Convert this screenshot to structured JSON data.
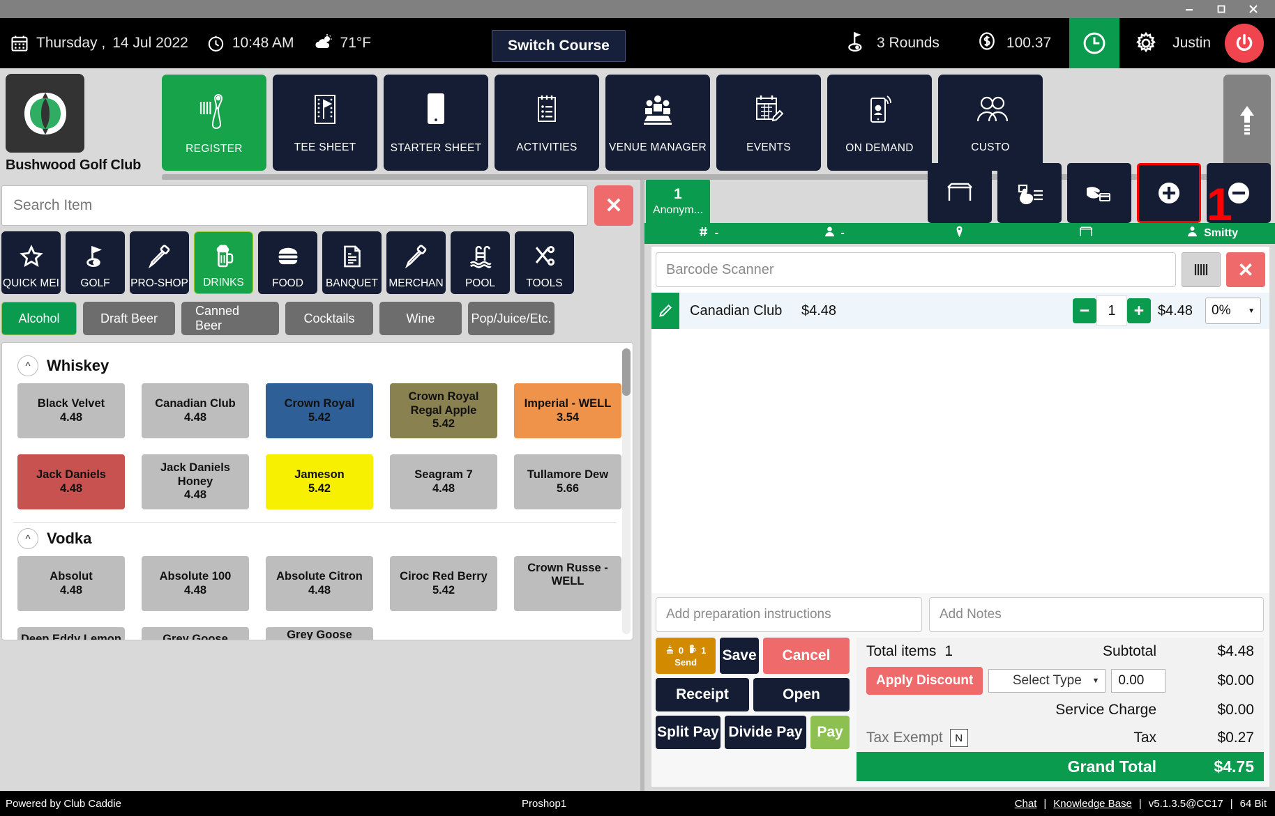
{
  "window": {
    "minimize": "minimize-icon",
    "maximize": "maximize-icon",
    "close": "close-icon"
  },
  "topbar": {
    "day": "Thursday ,",
    "date": "14 Jul 2022",
    "time": "10:48 AM",
    "temperature": "71°F",
    "switch_course": "Switch Course",
    "rounds": "3 Rounds",
    "money": "100.37",
    "user": "Justin",
    "icons": [
      "calendar-icon",
      "clock-icon",
      "weather-icon",
      "golf-flag-icon",
      "dollar-icon",
      "time-clock-icon",
      "gear-icon",
      "power-icon"
    ]
  },
  "brand": {
    "club_name": "Bushwood Golf Club",
    "logo": "club-caddie-logo"
  },
  "modules": [
    {
      "label": "REGISTER",
      "icon": "barcode-scanner-icon",
      "active": true
    },
    {
      "label": "TEE SHEET",
      "icon": "tee-sheet-icon",
      "active": false
    },
    {
      "label": "STARTER SHEET",
      "icon": "tablet-icon",
      "active": false
    },
    {
      "label": "ACTIVITIES",
      "icon": "clipboard-icon",
      "active": false
    },
    {
      "label": "VENUE MANAGER",
      "icon": "venue-icon",
      "active": false
    },
    {
      "label": "EVENTS",
      "icon": "calendar-edit-icon",
      "active": false
    },
    {
      "label": "ON DEMAND",
      "icon": "mobile-signal-icon",
      "active": false
    },
    {
      "label": "CUSTO",
      "icon": "customers-icon",
      "active": false
    }
  ],
  "module_scroll": {
    "icon": "up-arrow-icon"
  },
  "search": {
    "placeholder": "Search Item",
    "value": "",
    "clear": "✕"
  },
  "categories": [
    {
      "label": "QUICK MEI",
      "icon": "star-icon",
      "active": false
    },
    {
      "label": "GOLF",
      "icon": "golf-icon",
      "active": false
    },
    {
      "label": "PRO-SHOP",
      "icon": "pro-shop-icon",
      "active": false
    },
    {
      "label": "DRINKS",
      "icon": "beer-icon",
      "active": true
    },
    {
      "label": "FOOD",
      "icon": "burger-icon",
      "active": false
    },
    {
      "label": "BANQUET",
      "icon": "invoice-icon",
      "active": false
    },
    {
      "label": "MERCHAN",
      "icon": "merchant-icon",
      "active": false
    },
    {
      "label": "POOL",
      "icon": "pool-icon",
      "active": false
    },
    {
      "label": "TOOLS",
      "icon": "tools-icon",
      "active": false
    }
  ],
  "subcategories": [
    {
      "label": "Alcohol",
      "active": true
    },
    {
      "label": "Draft Beer",
      "active": false
    },
    {
      "label": "Canned Beer",
      "active": false
    },
    {
      "label": "Cocktails",
      "active": false
    },
    {
      "label": "Wine",
      "active": false
    },
    {
      "label": "Pop/Juice/Etc.",
      "active": false
    }
  ],
  "item_groups": [
    {
      "name": "Whiskey",
      "items": [
        {
          "name": "Black Velvet",
          "price": "4.48",
          "color": "#bdbdbd",
          "text": "#111111"
        },
        {
          "name": "Canadian Club",
          "price": "4.48",
          "color": "#bdbdbd",
          "text": "#111111"
        },
        {
          "name": "Crown Royal",
          "price": "5.42",
          "color": "#2e5f96",
          "text": "#111111"
        },
        {
          "name": "Crown Royal Regal Apple",
          "price": "5.42",
          "color": "#8a8150",
          "text": "#111111"
        },
        {
          "name": "Imperial - WELL",
          "price": "3.54",
          "color": "#f0934a",
          "text": "#111111"
        },
        {
          "name": "Jack Daniels",
          "price": "4.48",
          "color": "#c8524f",
          "text": "#111111"
        },
        {
          "name": "Jack Daniels Honey",
          "price": "4.48",
          "color": "#bdbdbd",
          "text": "#111111"
        },
        {
          "name": "Jameson",
          "price": "5.42",
          "color": "#f7f000",
          "text": "#111111"
        },
        {
          "name": "Seagram 7",
          "price": "4.48",
          "color": "#bdbdbd",
          "text": "#111111"
        },
        {
          "name": "Tullamore Dew",
          "price": "5.66",
          "color": "#bdbdbd",
          "text": "#111111"
        }
      ]
    },
    {
      "name": "Vodka",
      "items": [
        {
          "name": "Absolut",
          "price": "4.48",
          "color": "#bdbdbd",
          "text": "#111111"
        },
        {
          "name": "Absolute 100",
          "price": "4.48",
          "color": "#bdbdbd",
          "text": "#111111"
        },
        {
          "name": "Absolute Citron",
          "price": "4.48",
          "color": "#bdbdbd",
          "text": "#111111"
        },
        {
          "name": "Ciroc Red Berry",
          "price": "5.42",
          "color": "#bdbdbd",
          "text": "#111111"
        },
        {
          "name": "Crown Russe - WELL",
          "price": "",
          "color": "#bdbdbd",
          "text": "#111111"
        },
        {
          "name": "Deep Eddy Lemon",
          "price": "",
          "color": "#bdbdbd",
          "text": "#111111"
        },
        {
          "name": "Grey Goose",
          "price": "",
          "color": "#bdbdbd",
          "text": "#111111"
        },
        {
          "name": "Grey Goose",
          "price": "",
          "color": "#bdbdbd",
          "text": "#111111"
        }
      ]
    }
  ],
  "order": {
    "tab_number": "1",
    "tab_name": "Anonym...",
    "tools": [
      {
        "icon": "table-icon",
        "highlight": false
      },
      {
        "icon": "hand-select-icon",
        "highlight": false
      },
      {
        "icon": "hand-card-icon",
        "highlight": false
      },
      {
        "icon": "plus-circle-icon",
        "highlight": true
      },
      {
        "icon": "minus-circle-icon",
        "highlight": false
      }
    ],
    "annotation": "1",
    "greenbar": [
      {
        "icon": "hash-icon",
        "label": "-"
      },
      {
        "icon": "person-icon",
        "label": "-"
      },
      {
        "icon": "tag-icon",
        "label": ""
      },
      {
        "icon": "table-icon",
        "label": ""
      },
      {
        "icon": "server-icon",
        "label": "Smitty"
      }
    ],
    "barcode": {
      "placeholder": "Barcode Scanner",
      "value": "",
      "scan_icon": "barcode-icon",
      "clear": "✕"
    },
    "lines": [
      {
        "name": "Canadian Club",
        "price": "$4.48",
        "qty": "1",
        "extended": "$4.48",
        "discount": "0%"
      }
    ],
    "prep_placeholder": "Add preparation instructions",
    "notes_placeholder": "Add Notes",
    "buttons": {
      "send": "Send",
      "send_food_count": "0",
      "send_drink_count": "1",
      "save": "Save",
      "cancel": "Cancel",
      "receipt": "Receipt",
      "open": "Open",
      "split_pay": "Split Pay",
      "divide_pay": "Divide Pay",
      "pay": "Pay"
    },
    "totals": {
      "total_items_label": "Total items",
      "total_items_value": "1",
      "subtotal_label": "Subtotal",
      "subtotal_value": "$4.48",
      "apply_discount": "Apply Discount",
      "discount_type": "Select Type",
      "discount_amount": "0.00",
      "discount_value": "$0.00",
      "service_charge_label": "Service Charge",
      "service_charge_value": "$0.00",
      "tax_exempt_label": "Tax Exempt",
      "tax_exempt_flag": "N",
      "tax_label": "Tax",
      "tax_value": "$0.27",
      "grand_total_label": "Grand Total",
      "grand_total_value": "$4.75"
    }
  },
  "footer": {
    "powered_by": "Powered by Club Caddie",
    "terminal": "Proshop1",
    "chat": "Chat",
    "knowledge_base": "Knowledge Base",
    "version": "v5.1.3.5@CC17",
    "bits": "64 Bit",
    "sep": "|"
  },
  "colors": {
    "green": "#0a9b4e",
    "navy": "#141d33",
    "red": "#ef6b6b",
    "annotation_red": "#ff0000"
  }
}
